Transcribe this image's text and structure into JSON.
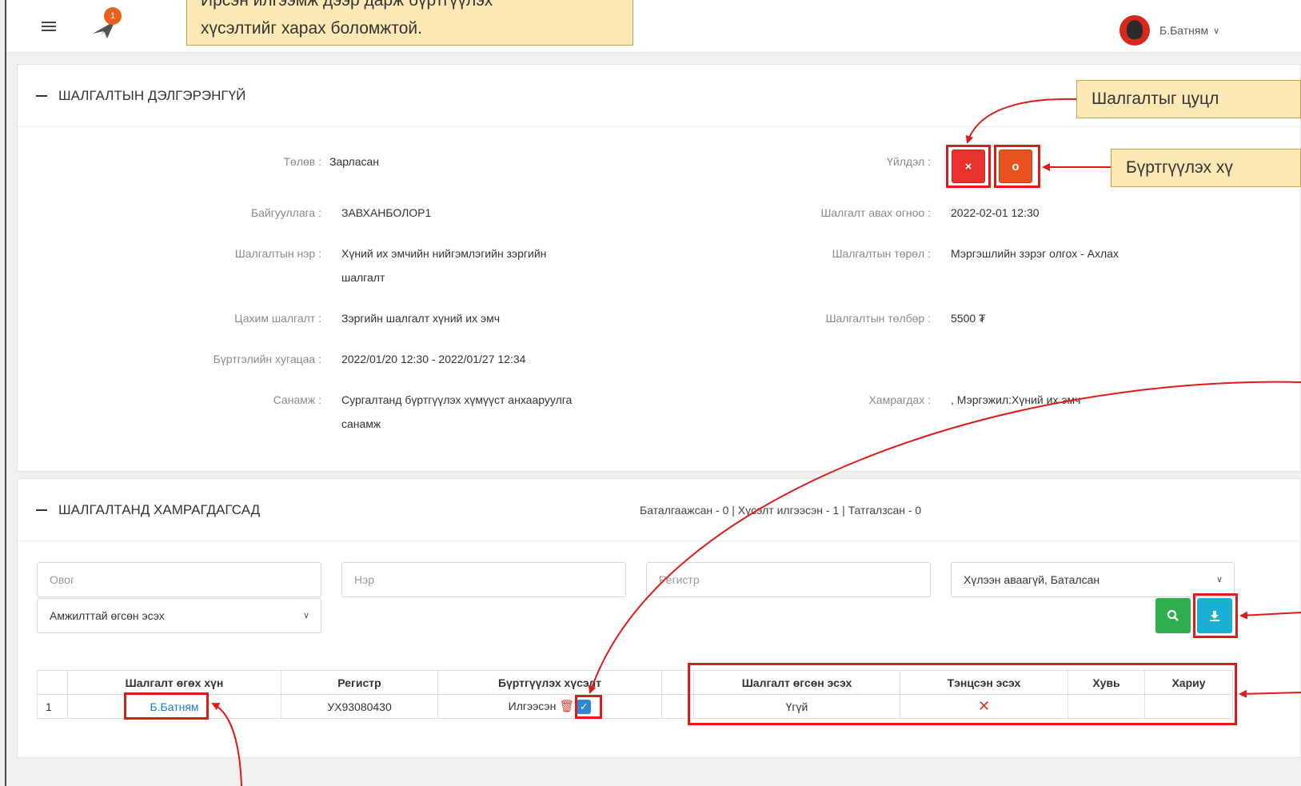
{
  "topbar": {
    "notification_count": "1",
    "user_name": "Б.Батням"
  },
  "callouts": {
    "top": "Ирсэн илгээмж дээр дарж бүртгүүлэх хүсэлтийг харах боломжтой.",
    "top_line1": "Ирсэн илгээмж дээр дарж бүртгүүлэх",
    "top_line2": "хүсэлтийг харах боломжтой.",
    "cancel": "Шалгалтыг цуцл",
    "register": "Бүртгүүлэх хү"
  },
  "details": {
    "title": "ШАЛГАЛТЫН ДЭЛГЭРЭНГҮЙ",
    "fields": {
      "status": {
        "label": "Төлөв :",
        "value": "Зарласан"
      },
      "action": {
        "label": "Үйлдэл :"
      },
      "organization": {
        "label": "Байгууллага :",
        "value": "ЗАВХАНБОЛОР1"
      },
      "exam_date": {
        "label": "Шалгалт авах огноо :",
        "value": "2022-02-01 12:30"
      },
      "exam_name": {
        "label": "Шалгалтын нэр :",
        "value_line1": "Хүний их эмчийн нийгэмлэгийн зэргийн",
        "value_line2": "шалгалт"
      },
      "exam_type": {
        "label": "Шалгалтын төрөл :",
        "value": "Мэргэшлийн зэрэг олгох - Ахлах"
      },
      "online_exam": {
        "label": "Цахим шалгалт :",
        "value": "Зэргийн шалгалт хүний их эмч"
      },
      "exam_fee": {
        "label": "Шалгалтын төлбөр :",
        "value": "5500 ₮"
      },
      "reg_period": {
        "label": "Бүртгэлийн хугацаа :",
        "value": "2022/01/20 12:30 - 2022/01/27 12:34"
      },
      "notice": {
        "label": "Санамж :",
        "value_line1": "Сургалтанд бүртгүүлэх хүмүүст анхааруулга",
        "value_line2": "санамж"
      },
      "coverage": {
        "label": "Хамрагдах :",
        "value": ", Мэргэжил:Хүний их эмч"
      }
    },
    "buttons": {
      "cancel": "×",
      "register": "o"
    }
  },
  "participants": {
    "title": "ШАЛГАЛТАНД ХАМРАГДАГСАД",
    "stats": "Баталгаажсан - 0 | Хүсэлт илгээсэн - 1 | Татгалзсан - 0",
    "filters": {
      "lastname_placeholder": "Овог",
      "firstname_placeholder": "Нэр",
      "register_placeholder": "Регистр",
      "status_selected": "Хүлээн аваагүй, Баталсан",
      "passed_selected": "Амжилттай өгсөн эсэх"
    },
    "table": {
      "headers": [
        "",
        "Шалгалт өгөх хүн",
        "Регистр",
        "Бүртгүүлэх хүсэлт",
        "",
        "Шалгалт өгсөн эсэх",
        "Тэнцсэн эсэх",
        "Хувь",
        "Хариу"
      ],
      "rows": [
        {
          "num": "1",
          "name": "Б.Батням",
          "register": "УХ93080430",
          "request": "Илгээсэн",
          "taken": "Үгүй",
          "passed": "✕",
          "percent": "",
          "result": ""
        }
      ]
    }
  },
  "colors": {
    "accent_orange": "#e8521e",
    "highlight_red": "#e01919",
    "callout_bg": "#fde9b6",
    "link_blue": "#1a7bd6"
  }
}
